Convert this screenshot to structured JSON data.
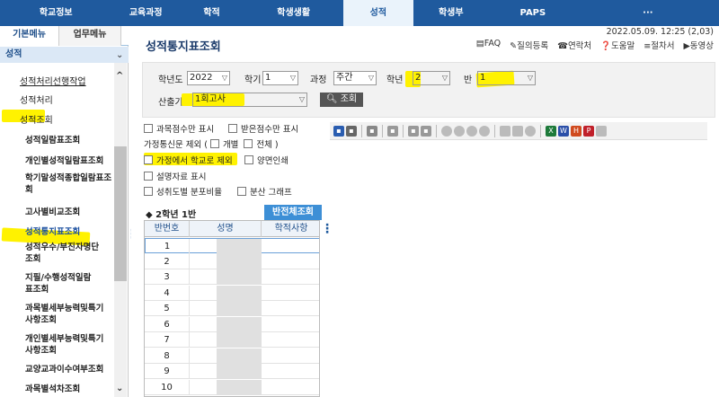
{
  "topnav": {
    "tabs": [
      {
        "label": "학교정보"
      },
      {
        "label": "교육과정"
      },
      {
        "label": "학적"
      },
      {
        "label": "학생생활"
      },
      {
        "label": "성적",
        "active": true
      },
      {
        "label": "학생부"
      },
      {
        "label": "PAPS"
      },
      {
        "label": "···"
      }
    ]
  },
  "sidebar": {
    "tabs": [
      "기본메뉴",
      "업무메뉴"
    ],
    "category": "성적",
    "items": [
      "성적처리선행작업",
      "성적처리",
      "성적조회",
      "성적일람표조회",
      "개인별성적일람표조회",
      "학기말성적종합일람표조회",
      "고사별비교조회",
      "성적통지표조회",
      "성적우수/부진자명단조회",
      "지필/수행성적일람표조회",
      "과목별세부능력및특기사항조회",
      "개인별세부능력및특기사항조회",
      "교양교과이수여부조회",
      "과목별석차조회"
    ],
    "selected_index": 7
  },
  "page": {
    "title": "성적통지표조회",
    "datetime": "2022.05.09. 12:25 (2,03)",
    "links": [
      "FAQ",
      "질의등록",
      "연락처",
      "도움말",
      "절차서",
      "동영상"
    ]
  },
  "filter": {
    "year_label": "학년도",
    "year_value": "2022",
    "semester_label": "학기",
    "semester_value": "1",
    "course_label": "과정",
    "course_value": "주간",
    "grade_label": "학년",
    "grade_value": "2",
    "class_label": "반",
    "class_value": "1",
    "basis_label": "산출기준",
    "basis_value": "1회고사",
    "search_label": "조회"
  },
  "options": {
    "opt1": "과목점수만 표시",
    "opt2": "받은점수만 표시",
    "family_label": "가정통신문 제외 (",
    "individual": "개별",
    "all": "전체 )",
    "home_school": "가정에서 학교로 제외",
    "duplex": "양면인쇄",
    "survey": "설명자료 표시",
    "dist_ratio": "성취도별 분포비율",
    "dist_graph": "분산 그래프"
  },
  "classbar": {
    "label": "◆ 2학년 1반",
    "button": "반전체조회"
  },
  "grid": {
    "headers": [
      "반번호",
      "성명",
      "학적사항"
    ],
    "rows": [
      "1",
      "2",
      "3",
      "4",
      "5",
      "6",
      "7",
      "8",
      "9",
      "10"
    ]
  },
  "colors": {
    "nav": "#1f5a9e",
    "accent": "#3d8fd6",
    "highlight": "#fff200"
  }
}
